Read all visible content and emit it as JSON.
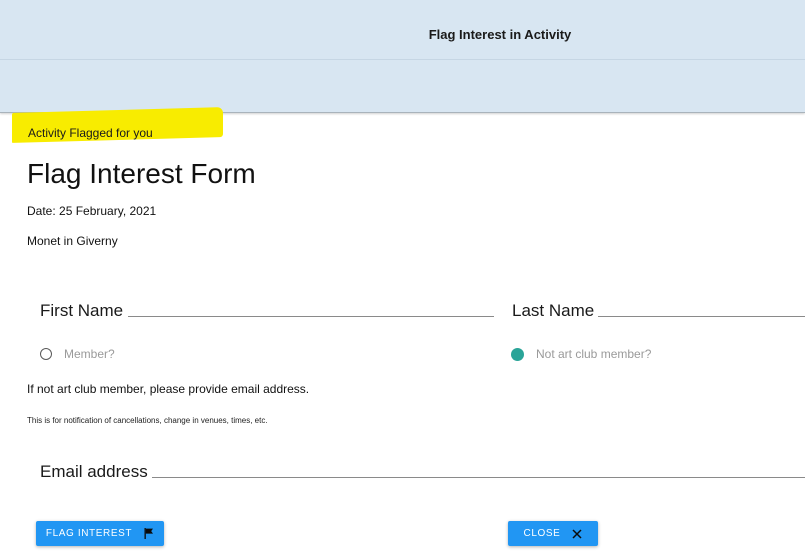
{
  "header": {
    "title": "Flag Interest in Activity"
  },
  "notice": {
    "text": "Activity Flagged for you",
    "highlight_color": "#f8ec00"
  },
  "form": {
    "title": "Flag Interest Form",
    "date": "Date: 25 February, 2021",
    "activity": "Monet in Giverny",
    "first_name_label": "First Name",
    "last_name_label": "Last Name",
    "membership": {
      "options": [
        {
          "label": "Member?",
          "selected": false
        },
        {
          "label": "Not art club member?",
          "selected": true
        }
      ],
      "selected_color": "#2aa498"
    },
    "instruction": "If not art club member, please provide email address.",
    "fineprint": "This is for notification of cancellations, change in venues, times, etc.",
    "email_label": "Email address"
  },
  "buttons": {
    "flag_label": "FLAG INTEREST",
    "flag_icon": "flag-icon",
    "close_label": "CLOSE",
    "close_icon": "close-icon",
    "color": "#2196f3"
  }
}
